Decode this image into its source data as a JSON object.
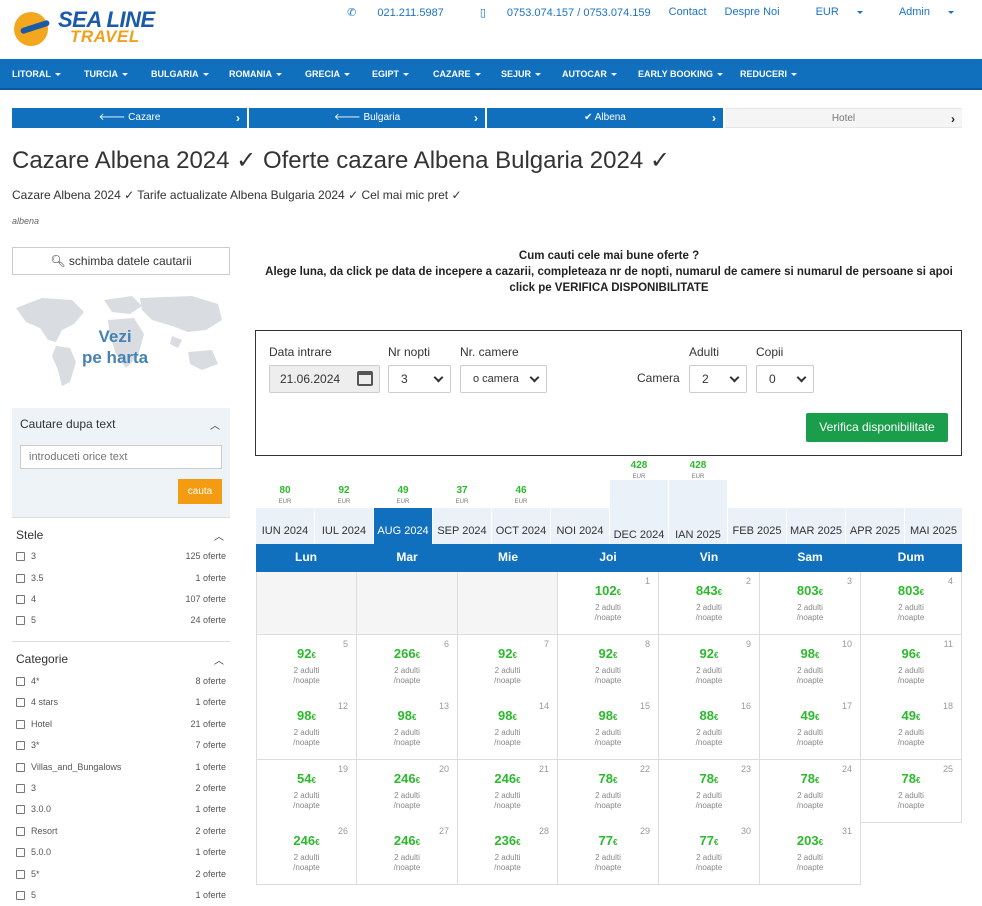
{
  "brand": {
    "name": "SEA LINE",
    "sub": "TRAVEL"
  },
  "top_links": {
    "phone1": "021.211.5987",
    "phone2": "0753.074.157 / 0753.074.159",
    "contact": "Contact",
    "about": "Despre Noi",
    "currency": "EUR",
    "admin": "Admin"
  },
  "nav": [
    "LITORAL",
    "TURCIA",
    "BULGARIA",
    "ROMANIA",
    "GRECIA",
    "EGIPT",
    "CAZARE",
    "SEJUR",
    "AUTOCAR",
    "EARLY BOOKING",
    "REDUCERI"
  ],
  "steps": [
    {
      "icon": "arrow-left-icon",
      "label": "Cazare"
    },
    {
      "icon": "arrow-left-icon",
      "label": "Bulgaria"
    },
    {
      "icon": "check-icon",
      "label": "Albena"
    },
    {
      "icon": "",
      "label": "Hotel"
    }
  ],
  "page": {
    "title": "Cazare Albena 2024 ✓ Oferte cazare Albena Bulgaria 2024 ✓",
    "subtitle": "Cazare Albena 2024 ✓ Tarife actualizate Albena Bulgaria 2024 ✓ Cel mai mic pret ✓",
    "tag": "albena"
  },
  "sidebar": {
    "change_search": "schimba datele cautarii",
    "map_label_1": "Vezi",
    "map_label_2": "pe harta",
    "text_search": {
      "title": "Cautare dupa text",
      "placeholder": "introduceti orice text",
      "button": "cauta"
    },
    "stars": {
      "title": "Stele",
      "items": [
        {
          "label": "3",
          "count": "125 oferte"
        },
        {
          "label": "3.5",
          "count": "1 oferte"
        },
        {
          "label": "4",
          "count": "107 oferte"
        },
        {
          "label": "5",
          "count": "24 oferte"
        }
      ]
    },
    "category": {
      "title": "Categorie",
      "items": [
        {
          "label": "4*",
          "count": "8 oferte"
        },
        {
          "label": "4 stars",
          "count": "1 oferte"
        },
        {
          "label": "Hotel",
          "count": "21 oferte"
        },
        {
          "label": "3*",
          "count": "7 oferte"
        },
        {
          "label": "Villas_and_Bungalows",
          "count": "1 oferte"
        },
        {
          "label": "3",
          "count": "2 oferte"
        },
        {
          "label": "3.0.0",
          "count": "1 oferte"
        },
        {
          "label": "Resort",
          "count": "2 oferte"
        },
        {
          "label": "5.0.0",
          "count": "1 oferte"
        },
        {
          "label": "5*",
          "count": "2 oferte"
        },
        {
          "label": "5",
          "count": "1 oferte"
        }
      ]
    }
  },
  "intro": {
    "line1": "Cum cauti cele mai bune oferte ?",
    "line2": "Alege luna, da click pe data de incepere a cazarii, completeaza nr de nopti, numarul de camere si numarul de persoane si apoi click pe VERIFICA DISPONIBILITATE"
  },
  "form": {
    "date_label": "Data intrare",
    "date_value": "21.06.2024",
    "nights_label": "Nr nopti",
    "nights_value": "3",
    "rooms_label": "Nr. camere",
    "rooms_value": "o camera",
    "room_label": "Camera",
    "adults_label": "Adulti",
    "adults_value": "2",
    "children_label": "Copii",
    "children_value": "0",
    "submit": "Verifica disponibilitate"
  },
  "months": [
    {
      "label": "IUN 2024",
      "price": ""
    },
    {
      "label": "IUL 2024",
      "price": ""
    },
    {
      "label": "AUG 2024",
      "price": ""
    },
    {
      "label": "SEP 2024",
      "price": ""
    },
    {
      "label": "OCT 2024",
      "price": ""
    },
    {
      "label": "NOI 2024",
      "price": ""
    },
    {
      "label": "DEC 2024",
      "price": "428"
    },
    {
      "label": "IAN 2025",
      "price": "428"
    },
    {
      "label": "FEB 2025",
      "price": ""
    },
    {
      "label": "MAR 2025",
      "price": ""
    },
    {
      "label": "APR 2025",
      "price": ""
    },
    {
      "label": "MAI 2025",
      "price": ""
    }
  ],
  "month_prices_low": [
    {
      "month": "IUN 2024",
      "price": "80"
    },
    {
      "month": "IUL 2024",
      "price": "92"
    },
    {
      "month": "AUG 2024",
      "price": "49"
    },
    {
      "month": "SEP 2024",
      "price": "37"
    },
    {
      "month": "OCT 2024",
      "price": "46"
    }
  ],
  "currency_label": "EUR",
  "active_month": "AUG 2024",
  "weekdays": [
    "Lun",
    "Mar",
    "Mie",
    "Joi",
    "Vin",
    "Sam",
    "Dum"
  ],
  "calendar": {
    "euro": "€",
    "note_1": "2 adulti",
    "note_2": "/noapte",
    "leading_empty": 3,
    "days": [
      {
        "d": "1",
        "p": "102"
      },
      {
        "d": "2",
        "p": "843"
      },
      {
        "d": "3",
        "p": "803"
      },
      {
        "d": "4",
        "p": "803"
      },
      {
        "d": "5",
        "p": "92"
      },
      {
        "d": "6",
        "p": "266"
      },
      {
        "d": "7",
        "p": "92"
      },
      {
        "d": "8",
        "p": "92"
      },
      {
        "d": "9",
        "p": "92"
      },
      {
        "d": "10",
        "p": "98"
      },
      {
        "d": "11",
        "p": "96"
      },
      {
        "d": "12",
        "p": "98"
      },
      {
        "d": "13",
        "p": "98"
      },
      {
        "d": "14",
        "p": "98"
      },
      {
        "d": "15",
        "p": "98"
      },
      {
        "d": "16",
        "p": "88"
      },
      {
        "d": "17",
        "p": "49"
      },
      {
        "d": "18",
        "p": "49"
      },
      {
        "d": "19",
        "p": "54"
      },
      {
        "d": "20",
        "p": "246"
      },
      {
        "d": "21",
        "p": "246"
      },
      {
        "d": "22",
        "p": "78"
      },
      {
        "d": "23",
        "p": "78"
      },
      {
        "d": "24",
        "p": "78"
      },
      {
        "d": "25",
        "p": "78"
      },
      {
        "d": "26",
        "p": "246"
      },
      {
        "d": "27",
        "p": "246"
      },
      {
        "d": "28",
        "p": "236"
      },
      {
        "d": "29",
        "p": "77"
      },
      {
        "d": "30",
        "p": "77"
      },
      {
        "d": "31",
        "p": "203"
      }
    ]
  },
  "colors": {
    "primary": "#1070bd",
    "price": "#2cba2c",
    "accent": "#f39c12",
    "success": "#1a9e4b"
  }
}
